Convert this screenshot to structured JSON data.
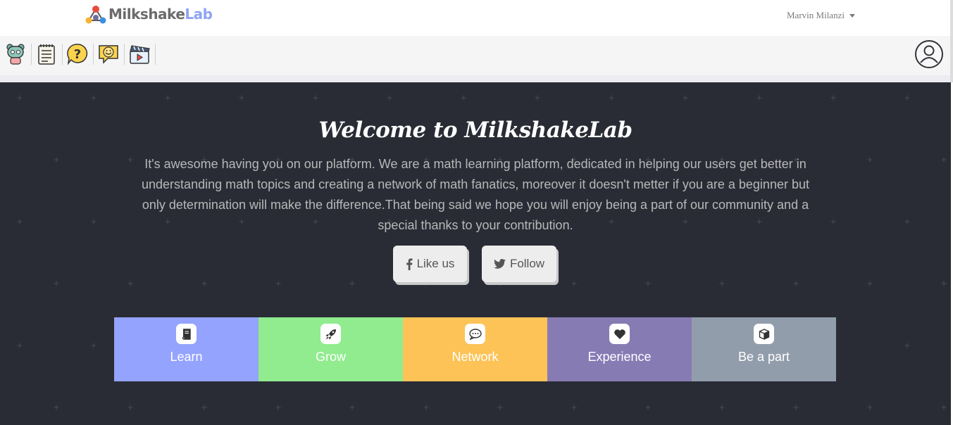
{
  "brand": {
    "name_part1": "Milkshake",
    "name_part2": "Lab"
  },
  "user_menu": {
    "name": "Marvin Milanzi"
  },
  "toolbar": {
    "icons": [
      "robot-icon",
      "notepad-icon",
      "help-icon",
      "chat-smile-icon",
      "video-clapper-icon"
    ],
    "avatar": "user-avatar-icon"
  },
  "hero": {
    "title": "Welcome to MilkshakeLab",
    "description": "It's awesome having you on our platform. We are a math learning platform, dedicated in helping our users get better in understanding math topics and creating a network of math fanatics, moreover it doesn't metter if you are a beginner but only determination will make the difference.That being said we hope you will enjoy being a part of our community and a special thanks to your contribution.",
    "like_label": "Like us",
    "follow_label": "Follow"
  },
  "features": [
    {
      "label": "Learn",
      "icon": "book-icon",
      "color": "#94a3fd"
    },
    {
      "label": "Grow",
      "icon": "rocket-icon",
      "color": "#90ec8e"
    },
    {
      "label": "Network",
      "icon": "comment-icon",
      "color": "#fdc357"
    },
    {
      "label": "Experience",
      "icon": "heart-icon",
      "color": "#877bb4"
    },
    {
      "label": "Be a part",
      "icon": "cube-icon",
      "color": "#929dab"
    }
  ],
  "colors": {
    "hero_bg": "#292c35",
    "brand_accent": "#8fa3f7"
  }
}
